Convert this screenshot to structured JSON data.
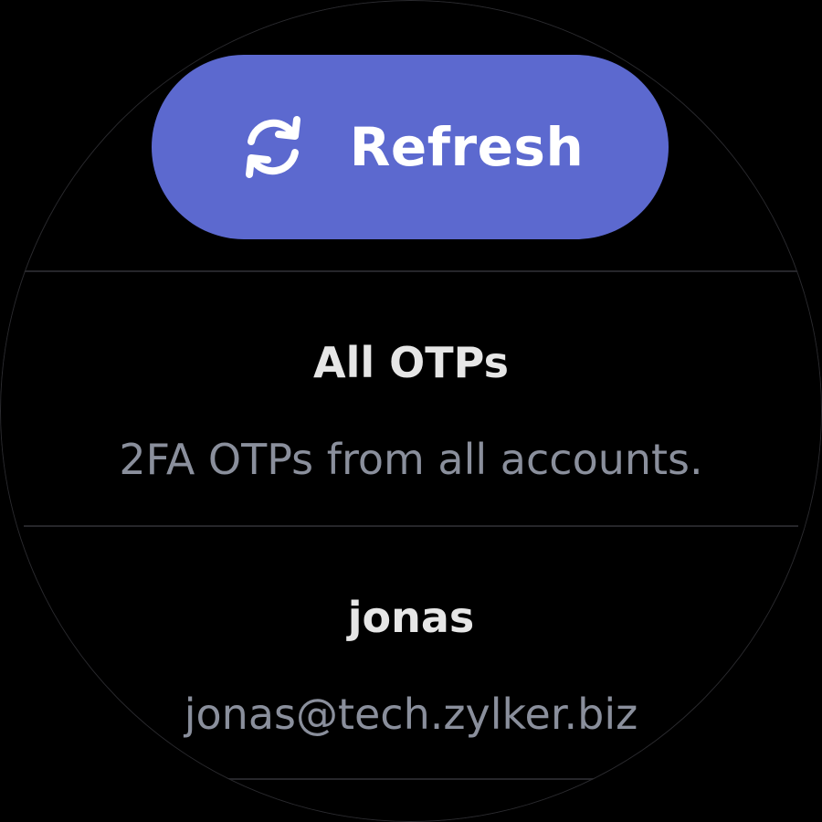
{
  "refresh_button": {
    "label": "Refresh",
    "icon": "refresh-icon",
    "color": "#5c69cf"
  },
  "accounts": [
    {
      "title": "All OTPs",
      "subtitle": "2FA OTPs from all accounts."
    },
    {
      "title": "jonas",
      "subtitle": "jonas@tech.zylker.biz"
    }
  ]
}
